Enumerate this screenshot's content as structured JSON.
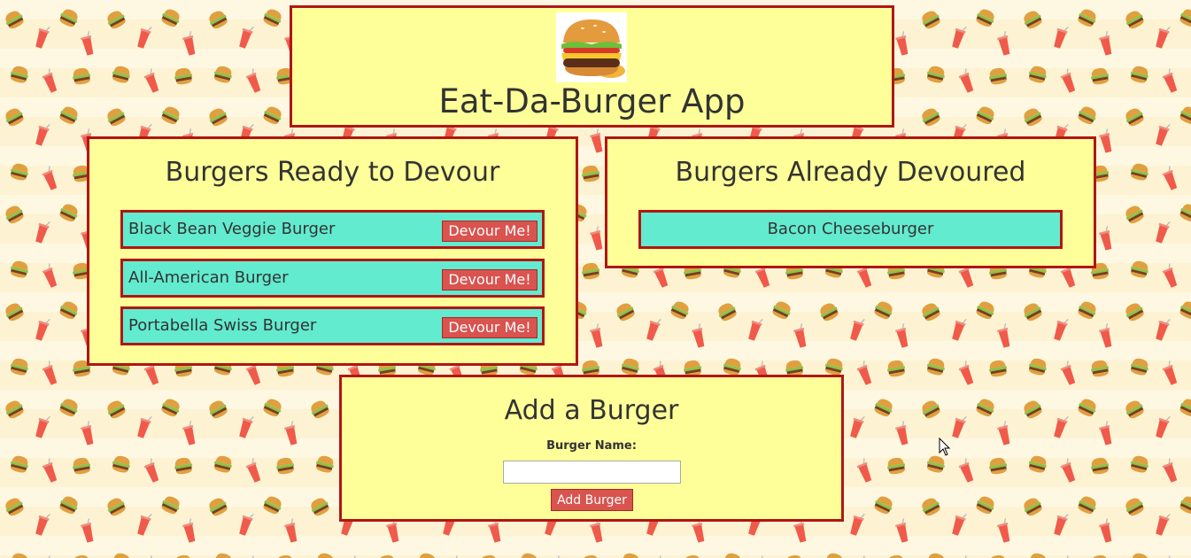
{
  "header": {
    "title": "Eat-Da-Burger App",
    "logo_icon": "burger-photo-icon"
  },
  "ready": {
    "title": "Burgers Ready to Devour",
    "items": [
      {
        "name": "Black Bean Veggie Burger",
        "button_label": "Devour Me!"
      },
      {
        "name": "All-American Burger",
        "button_label": "Devour Me!"
      },
      {
        "name": "Portabella Swiss Burger",
        "button_label": "Devour Me!"
      }
    ]
  },
  "devoured": {
    "title": "Burgers Already Devoured",
    "items": [
      {
        "name": "Bacon Cheeseburger"
      }
    ]
  },
  "add_form": {
    "title": "Add a Burger",
    "field_label": "Burger Name:",
    "input_value": "",
    "input_placeholder": "",
    "submit_label": "Add Burger"
  },
  "colors": {
    "panel_background": "#ffff99",
    "panel_border": "#b01616",
    "item_background": "#62ebcf",
    "button_background": "#d9534f",
    "page_background": "#fdf3d3"
  },
  "background_pattern_icons": [
    "burger-icon",
    "soda-cup-icon"
  ]
}
